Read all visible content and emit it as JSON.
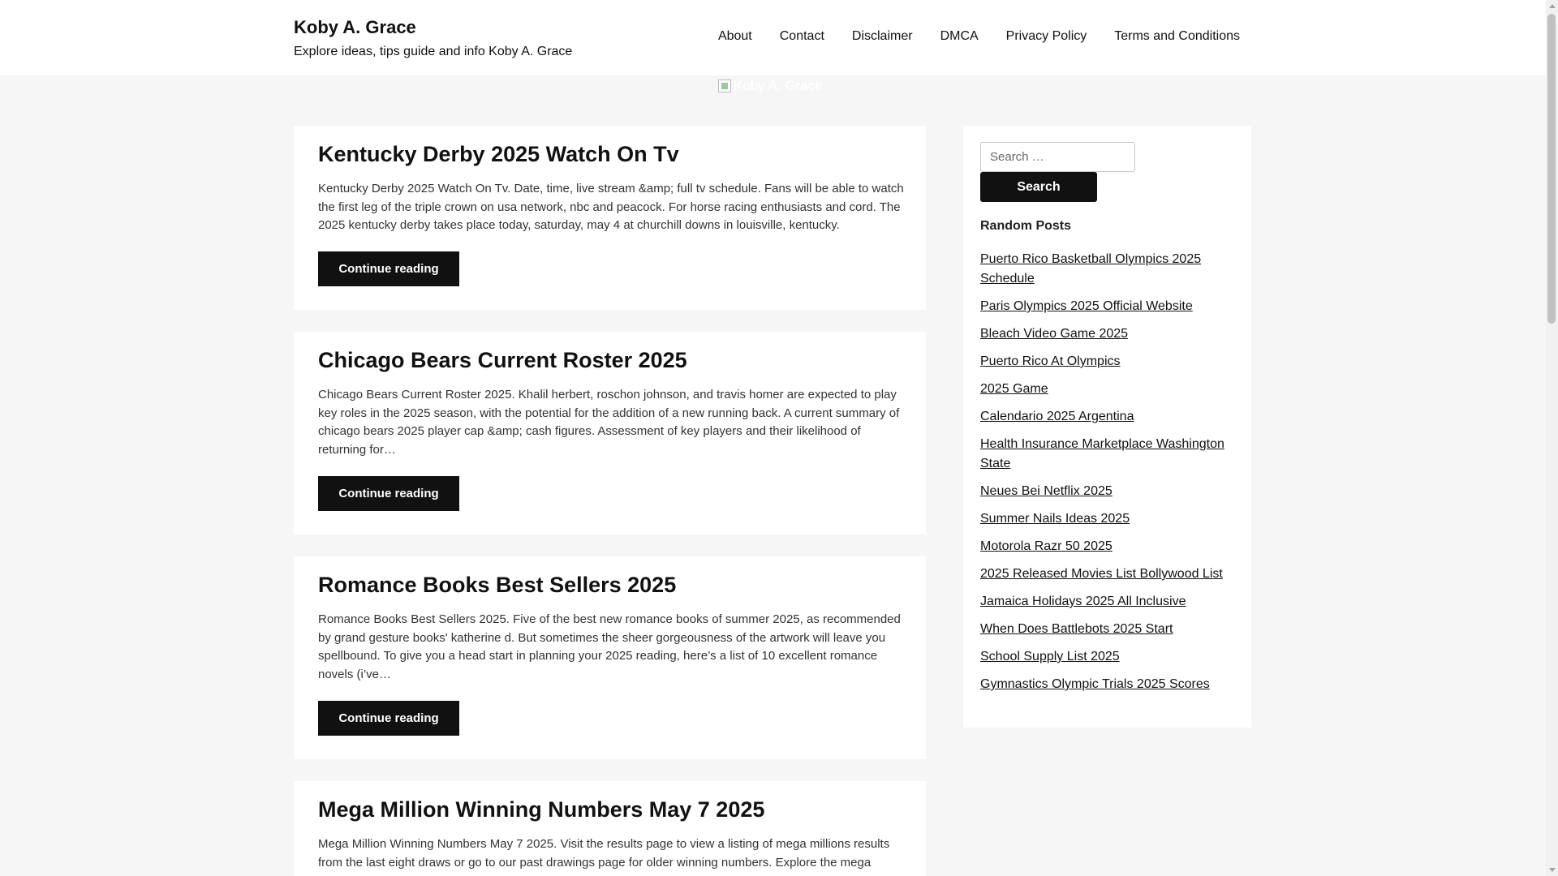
{
  "site": {
    "title": "Koby A. Grace",
    "tagline": "Explore ideas, tips guide and info Koby A. Grace",
    "banner_alt": "Koby A. Grace"
  },
  "nav": [
    "About",
    "Contact",
    "Disclaimer",
    "DMCA",
    "Privacy Policy",
    "Terms and Conditions"
  ],
  "posts": [
    {
      "title": "Kentucky Derby 2025 Watch On Tv",
      "excerpt": "Kentucky Derby 2025 Watch On Tv. Date, time, live stream &amp; full tv schedule. Fans will be able to watch the first leg of the triple crown on usa network, nbc and peacock. For horse racing enthusiasts and cord. The 2025 kentucky derby takes place today, saturday, may 4 at churchill downs in louisville, kentucky.",
      "button": "Continue reading"
    },
    {
      "title": "Chicago Bears Current Roster 2025",
      "excerpt": "Chicago Bears Current Roster 2025. Khalil herbert, roschon johnson, and travis homer are expected to play key roles in the 2025 season, with the potential for the addition of a new running back. A current summary of chicago bears 2025 player cap &amp; cash figures. Assessment of key players and their likelihood of returning for…",
      "button": "Continue reading"
    },
    {
      "title": "Romance Books Best Sellers 2025",
      "excerpt": "Romance Books Best Sellers 2025. Five of the best new romance books of summer 2025, as recommended by grand gesture books' katherine d. But sometimes the sheer gorgeousness of the artwork will leave you spellbound. To give you a head start in planning your 2025 reading, here’s a list of 10 excellent romance novels (i’ve…",
      "button": "Continue reading"
    },
    {
      "title": "Mega Million Winning Numbers May 7 2025",
      "excerpt": "Mega Million Winning Numbers May 7 2025. Visit the results page to view a listing of mega millions results from the last eight draws or go to our past drawings page for older winning numbers. Explore the mega",
      "button": "Continue reading"
    }
  ],
  "sidebar": {
    "search_placeholder": "Search …",
    "search_button": "Search",
    "widget_title": "Random Posts",
    "random_posts": [
      "Puerto Rico Basketball Olympics 2025 Schedule",
      "Paris Olympics 2025 Official Website",
      "Bleach Video Game 2025",
      "Puerto Rico At Olympics",
      "2025 Game",
      "Calendario 2025 Argentina",
      "Health Insurance Marketplace Washington State",
      "Neues Bei Netflix 2025",
      "Summer Nails Ideas 2025",
      "Motorola Razr 50 2025",
      "2025 Released Movies List Bollywood List",
      "Jamaica Holidays 2025 All Inclusive",
      "When Does Battlebots 2025 Start",
      "School Supply List 2025",
      "Gymnastics Olympic Trials 2025 Scores"
    ]
  }
}
